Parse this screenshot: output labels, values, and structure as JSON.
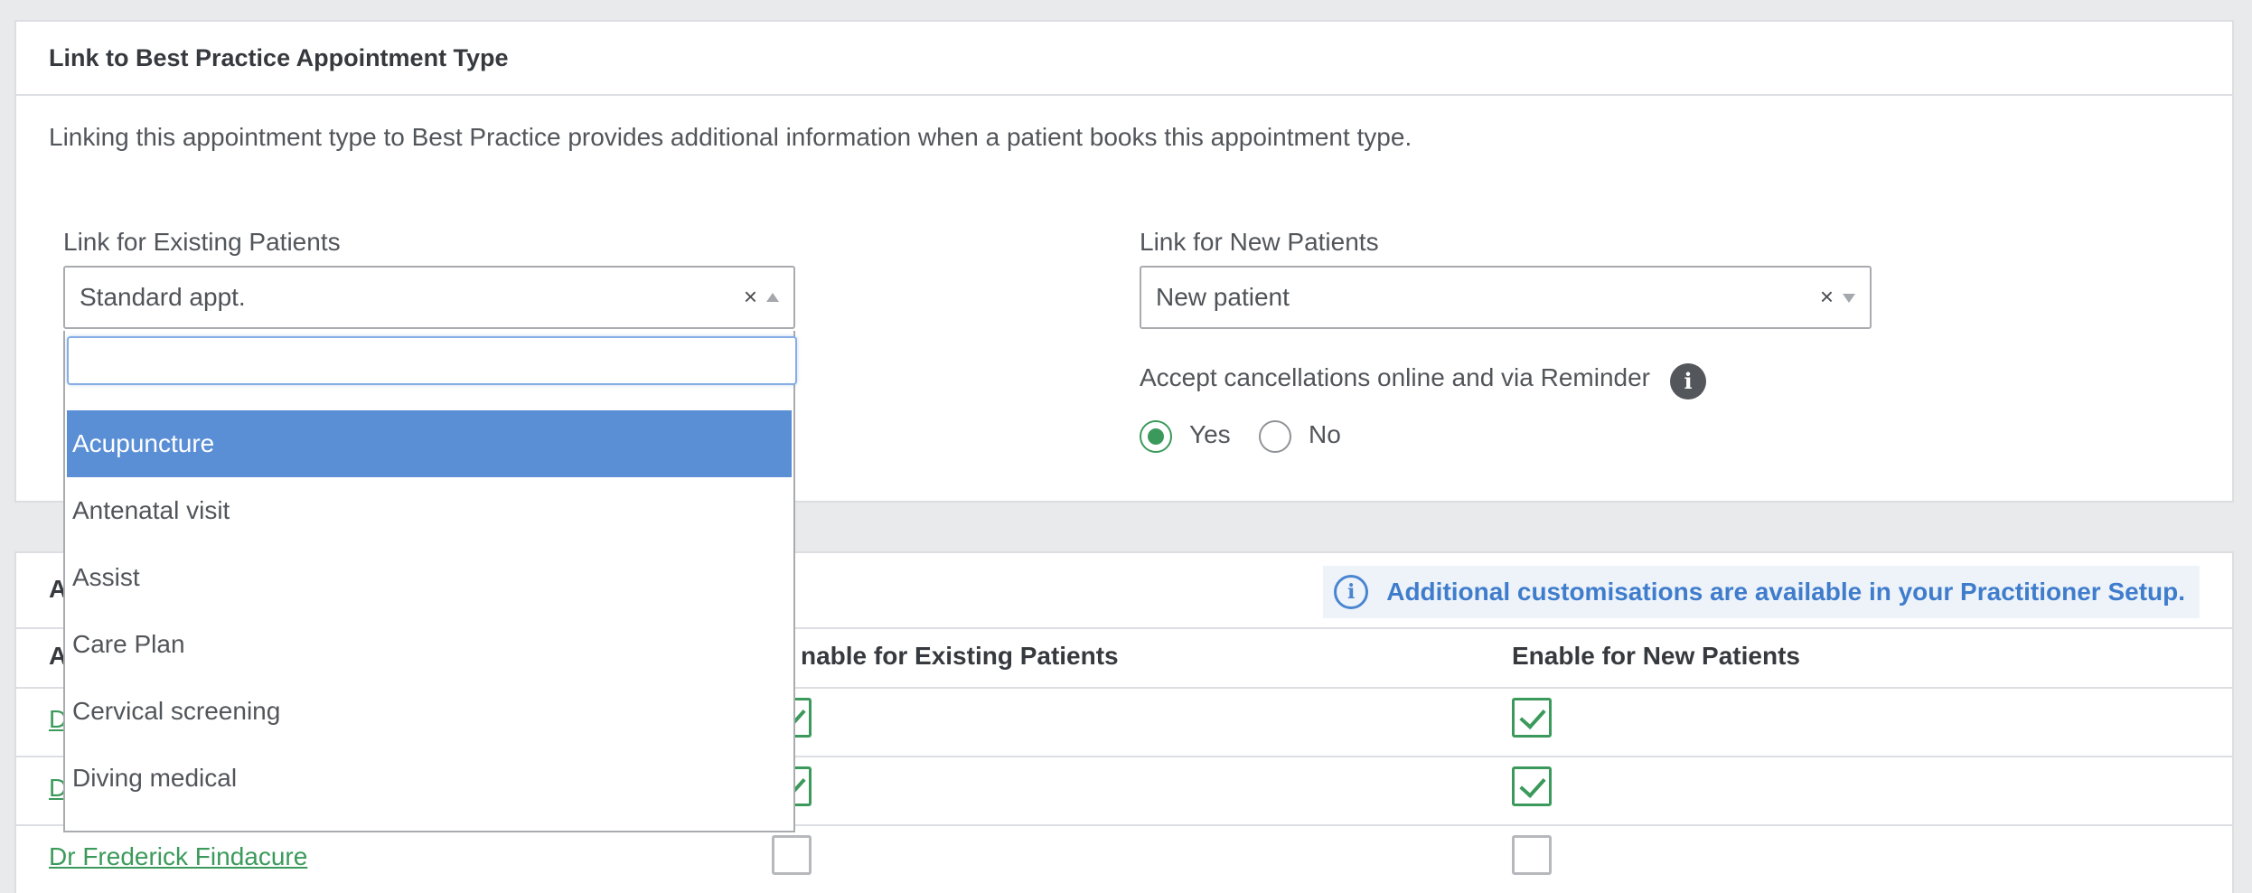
{
  "link_section": {
    "title": "Link to Best Practice Appointment Type",
    "description": "Linking this appointment type to Best Practice provides additional information when a patient books this appointment type.",
    "existing_label": "Link for Existing Patients",
    "existing_value": "Standard appt.",
    "new_label": "Link for New Patients",
    "new_value": "New patient",
    "clear_symbol": "×",
    "cancel_label": "Accept cancellations online and via Reminder",
    "info_symbol": "i",
    "yes_label": "Yes",
    "no_label": "No",
    "cancel_selected": "Yes"
  },
  "dropdown": {
    "search_value": "",
    "options": [
      "Acupuncture",
      "Antenatal visit",
      "Assist",
      "Care Plan",
      "Cervical screening",
      "Diving medical"
    ],
    "highlighted": "Acupuncture"
  },
  "practitioner_section": {
    "title_visible": "A",
    "notice": "Additional customisations are available in your Practitioner Setup.",
    "col_practitioner_visible": "A",
    "col_existing": "Enable for Existing Patients",
    "col_existing_visible": "nable for Existing Patients",
    "col_new": "Enable for New Patients",
    "rows": [
      {
        "name_visible": "D",
        "existing": true,
        "new": true
      },
      {
        "name_visible": "D",
        "existing": true,
        "new": true
      },
      {
        "name": "Dr Frederick Findacure",
        "existing": false,
        "new": false
      }
    ]
  },
  "colors": {
    "accent_green": "#3b9a5b",
    "highlight_blue": "#5a8fd5",
    "notice_blue": "#3f7dcc"
  }
}
